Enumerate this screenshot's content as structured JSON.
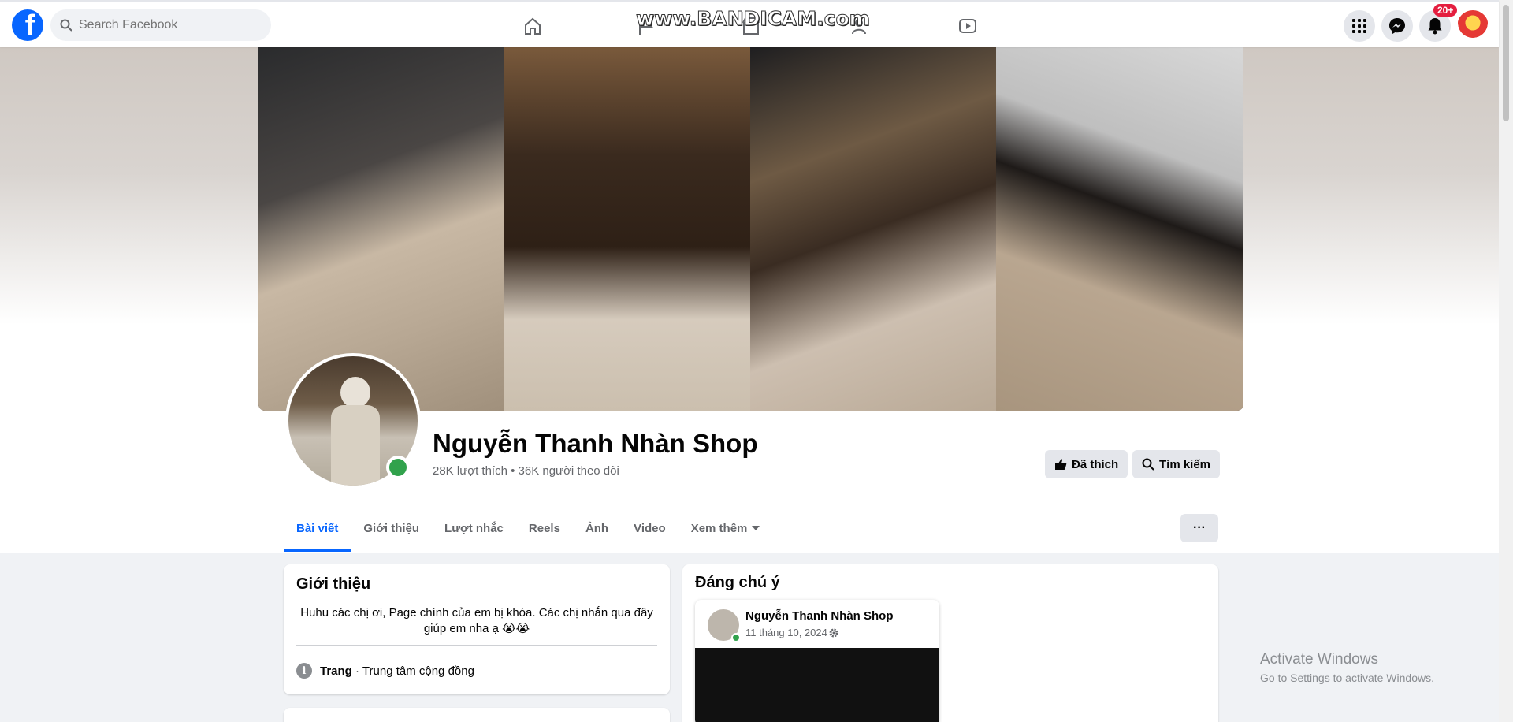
{
  "topbar": {
    "search_placeholder": "Search Facebook",
    "watermark": "www.BANDICAM.com",
    "notifications_badge": "20+"
  },
  "page": {
    "name": "Nguyễn Thanh Nhàn Shop",
    "stats": "28K lượt thích • 36K người theo dõi",
    "liked_label": "Đã thích",
    "search_label": "Tìm kiếm"
  },
  "tabs": [
    "Bài viết",
    "Giới thiệu",
    "Lượt nhắc",
    "Reels",
    "Ảnh",
    "Video",
    "Xem thêm"
  ],
  "more_button": "···",
  "intro": {
    "title": "Giới thiệu",
    "bio": "Huhu các chị ơi, Page chính của em bị khóa. Các chị nhắn qua đây giúp em nha ạ 😭😭",
    "category_strong": "Trang",
    "category_rest": " · Trung tâm cộng đồng"
  },
  "featured": {
    "title": "Đáng chú ý",
    "post_author": "Nguyễn Thanh Nhàn Shop",
    "post_date": "11 tháng 10, 2024"
  },
  "system": {
    "activate_title": "Activate Windows",
    "activate_sub": "Go to Settings to activate Windows."
  },
  "colors": {
    "brand": "#0866ff",
    "online": "#31a24c",
    "badge": "#e41e3f"
  }
}
